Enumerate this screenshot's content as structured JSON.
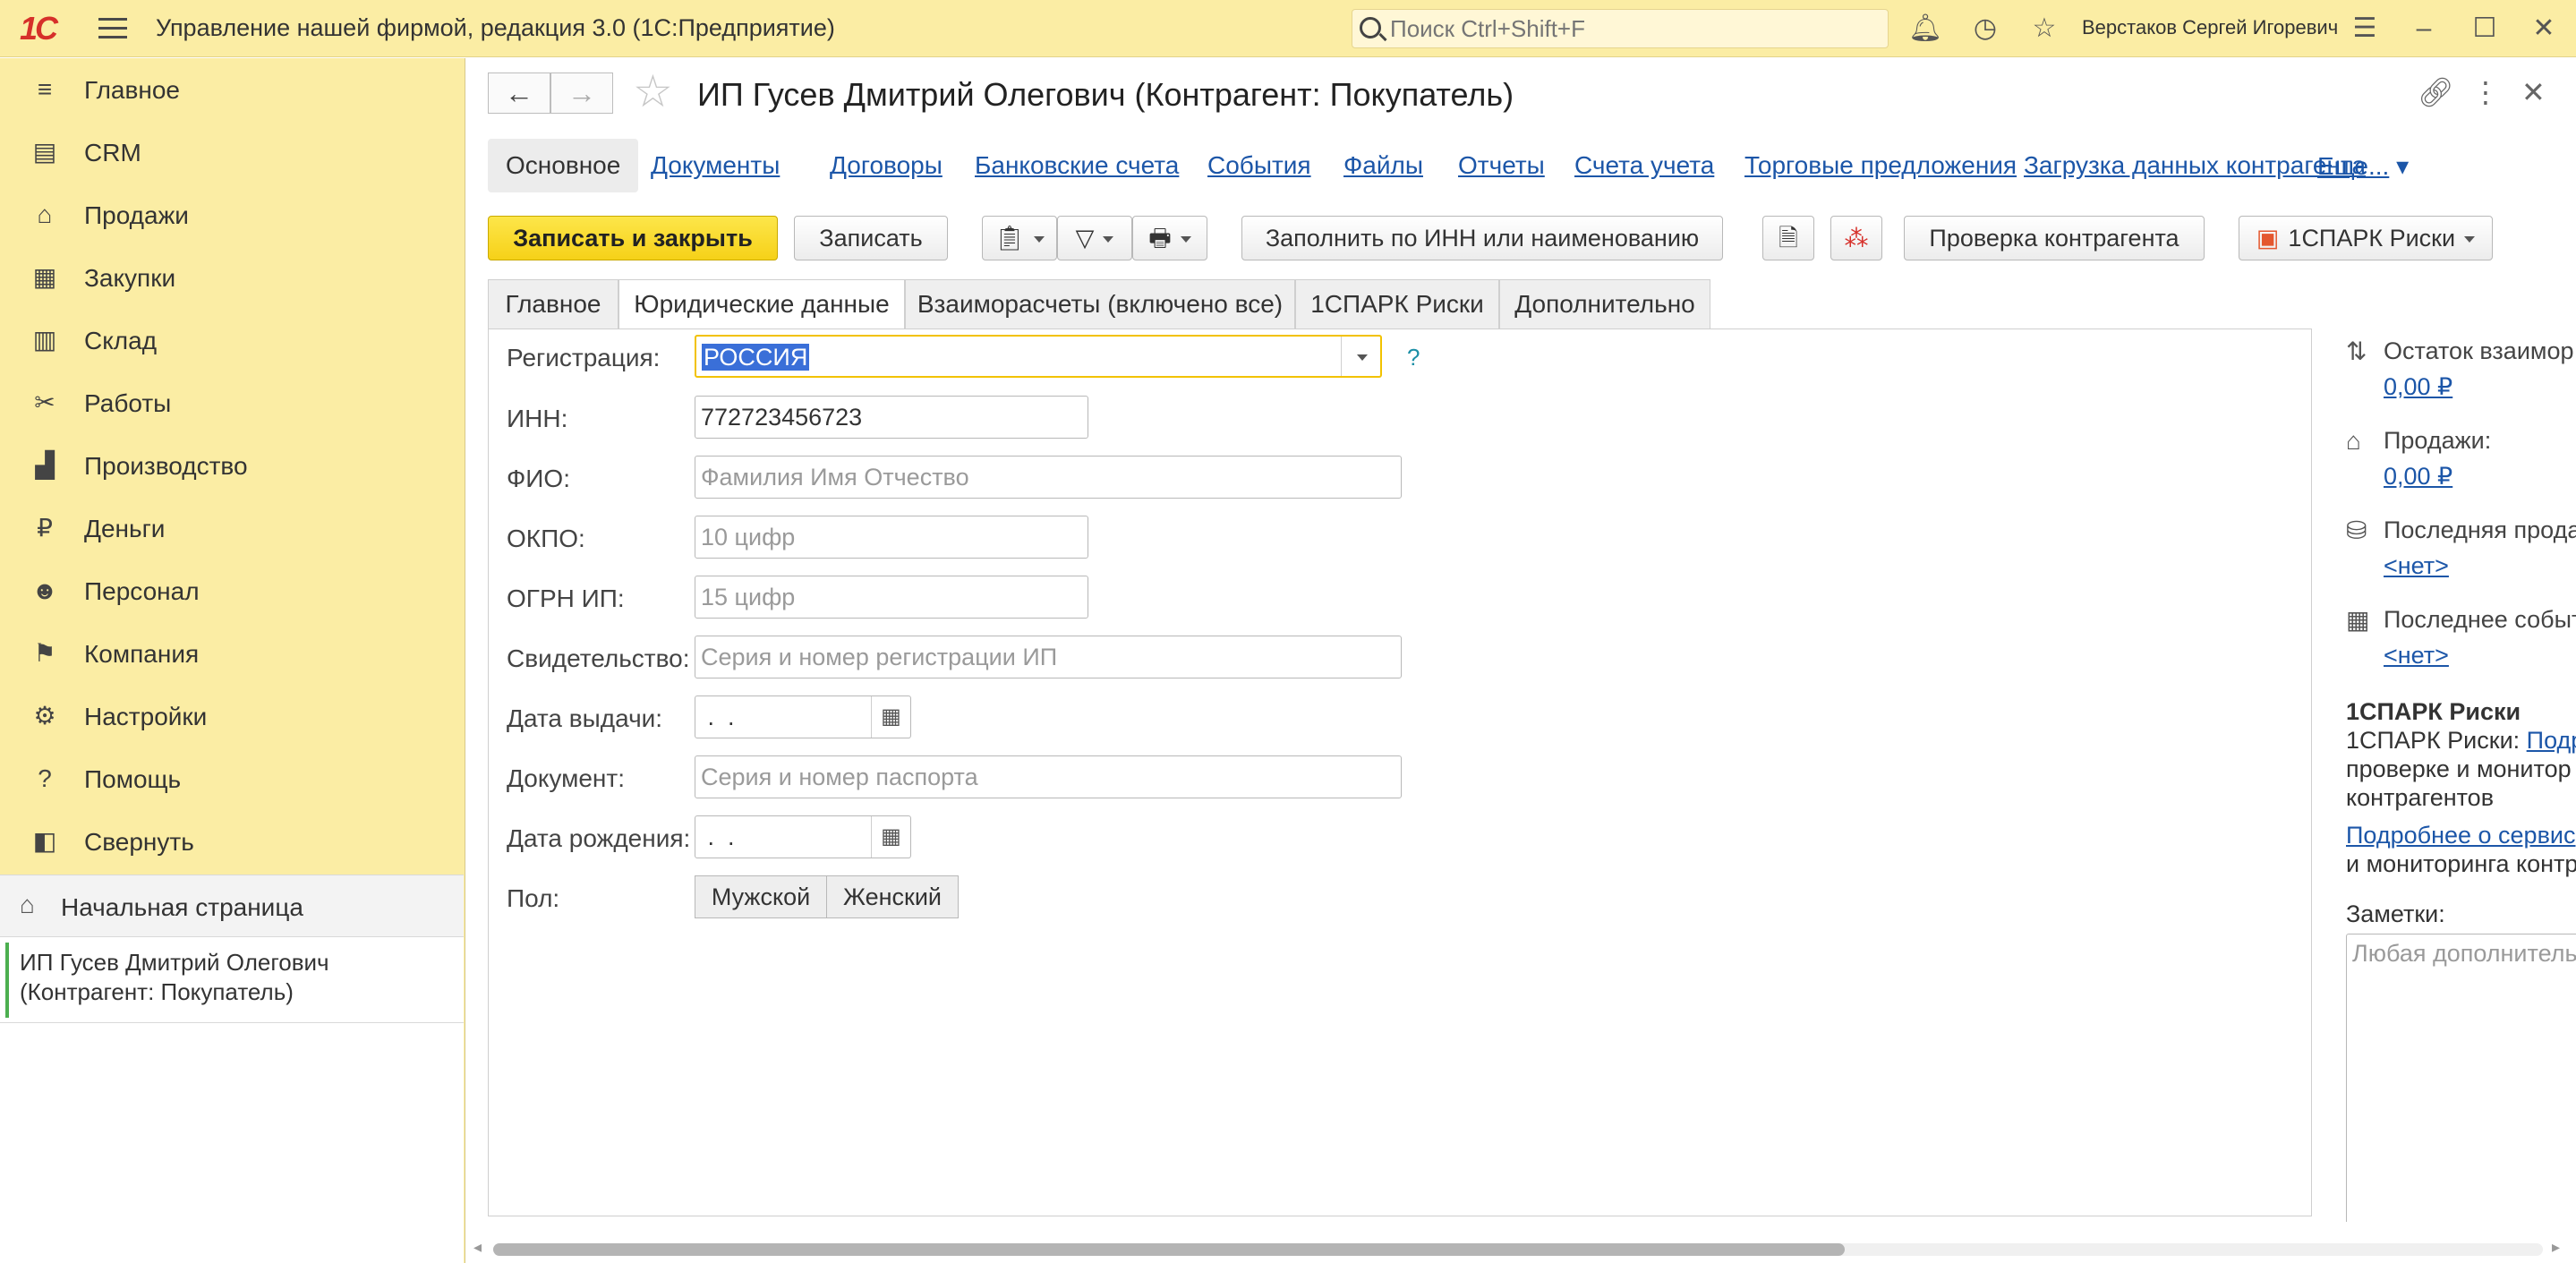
{
  "app": {
    "logo": "1С",
    "title": "Управление нашей фирмой, редакция 3.0  (1С:Предприятие)",
    "search_placeholder": "Поиск Ctrl+Shift+F",
    "user": "Верстаков Сергей Игоревич",
    "icons": [
      "bell-icon",
      "history-icon",
      "star-icon",
      "settings-lines-icon",
      "minimize-icon",
      "maximize-icon",
      "close-icon"
    ]
  },
  "sidebar": {
    "items": [
      {
        "label": "Главное",
        "icon": "≡"
      },
      {
        "label": "CRM",
        "icon": "▤"
      },
      {
        "label": "Продажи",
        "icon": "⌂"
      },
      {
        "label": "Закупки",
        "icon": "▦"
      },
      {
        "label": "Склад",
        "icon": "▥"
      },
      {
        "label": "Работы",
        "icon": "✂"
      },
      {
        "label": "Производство",
        "icon": "▟"
      },
      {
        "label": "Деньги",
        "icon": "₽"
      },
      {
        "label": "Персонал",
        "icon": "☻"
      },
      {
        "label": "Компания",
        "icon": "⚑"
      },
      {
        "label": "Настройки",
        "icon": "⚙"
      },
      {
        "label": "Помощь",
        "icon": "?"
      },
      {
        "label": "Свернуть",
        "icon": "◧"
      }
    ],
    "home": "Начальная страница",
    "open_doc": "ИП Гусев Дмитрий Олегович (Контрагент: Покупатель)"
  },
  "doc": {
    "title": "ИП Гусев Дмитрий Олегович (Контрагент: Покупатель)",
    "links": {
      "main": "Основное",
      "items": [
        "Документы",
        "Договоры",
        "Банковские счета",
        "События",
        "Файлы",
        "Отчеты",
        "Счета учета",
        "Торговые предложения",
        "Загрузка данных контрагента"
      ],
      "more": "Еще..."
    },
    "commands": {
      "save_close": "Записать и закрыть",
      "save": "Записать",
      "fill_inn": "Заполнить по ИНН или наименованию",
      "check": "Проверка контрагента",
      "spark": "1СПАРК Риски"
    },
    "tabs": [
      "Главное",
      "Юридические данные",
      "Взаиморасчеты (включено все)",
      "1СПАРК Риски",
      "Дополнительно"
    ],
    "form": {
      "registration": {
        "label": "Регистрация:",
        "value": "РОССИЯ"
      },
      "help": "?",
      "inn": {
        "label": "ИНН:",
        "value": "772723456723"
      },
      "fio": {
        "label": "ФИО:",
        "placeholder": "Фамилия Имя Отчество"
      },
      "okpo": {
        "label": "ОКПО:",
        "placeholder": "10 цифр"
      },
      "ogrn": {
        "label": "ОГРН ИП:",
        "placeholder": "15 цифр"
      },
      "certificate": {
        "label": "Свидетельство:",
        "placeholder": "Серия и номер регистрации ИП"
      },
      "issue_date": {
        "label": "Дата выдачи:",
        "value": " .  ."
      },
      "document": {
        "label": "Документ:",
        "placeholder": "Серия и номер паспорта"
      },
      "birth_date": {
        "label": "Дата рождения:",
        "value": " .  ."
      },
      "gender": {
        "label": "Пол:",
        "options": [
          "Мужской",
          "Женский"
        ]
      }
    },
    "info": {
      "balance_label": "Остаток взаимор",
      "balance_value": "0,00 ₽",
      "sales_label": "Продажи:",
      "sales_value": "0,00 ₽",
      "last_sale_label": "Последняя прода",
      "last_sale_value": "<нет>",
      "last_event_label": "Последнее событ",
      "last_event_value": "<нет>",
      "spark_title": "1СПАРК Риски",
      "spark_line1": "1СПАРК Риски: ",
      "spark_line1_link": "Подр",
      "spark_line2": "проверке и монитор",
      "spark_line3": "контрагентов",
      "spark_more_link": "Подробнее о сервис",
      "spark_line4": "и мониторинга контр",
      "notes_label": "Заметки:",
      "notes_placeholder": "Любая дополнитель"
    }
  }
}
